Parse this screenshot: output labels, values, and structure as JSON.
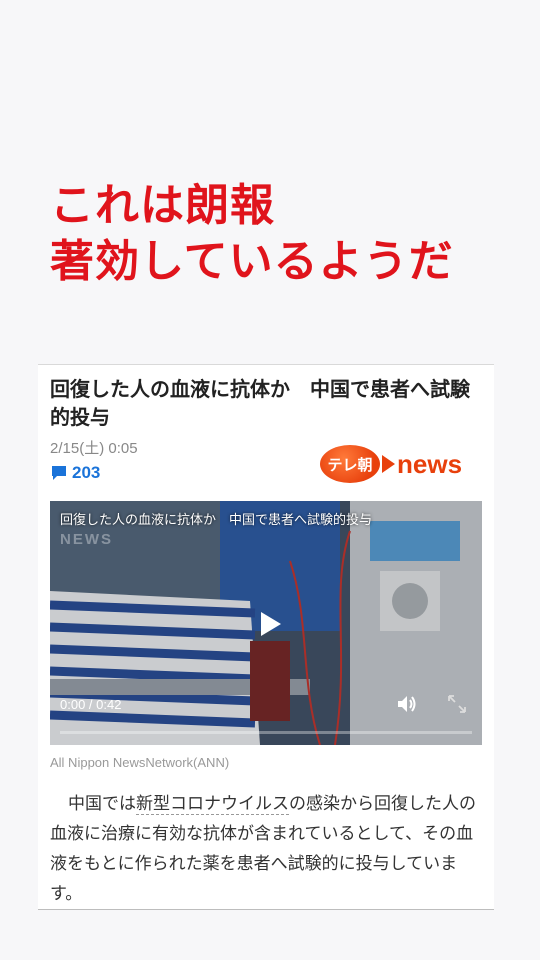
{
  "headline": {
    "line1": "これは朗報",
    "line2": "著効しているようだ"
  },
  "article": {
    "title": "回復した人の血液に抗体か　中国で患者へ試験的投与",
    "date": "2/15(土) 0:05",
    "comment_count": "203",
    "logo_badge": "テレ朝",
    "logo_word": "news",
    "video": {
      "caption": "回復した人の血液に抗体か　中国で患者へ試験的投与",
      "watermark": "NEWS",
      "time": "0:00 / 0:42",
      "progress": 0
    },
    "source": "All Nippon NewsNetwork(ANN)",
    "body": {
      "before": "中国では",
      "link": "新型コロナウイルス",
      "after": "の感染から回復した人の血液に治療に有効な抗体が含まれているとして、その血液をもとに作られた薬を患者へ試験的に投与しています。"
    }
  },
  "colors": {
    "headline": "#e0141c",
    "comment": "#1a73d9",
    "logo": "#e8400c"
  }
}
